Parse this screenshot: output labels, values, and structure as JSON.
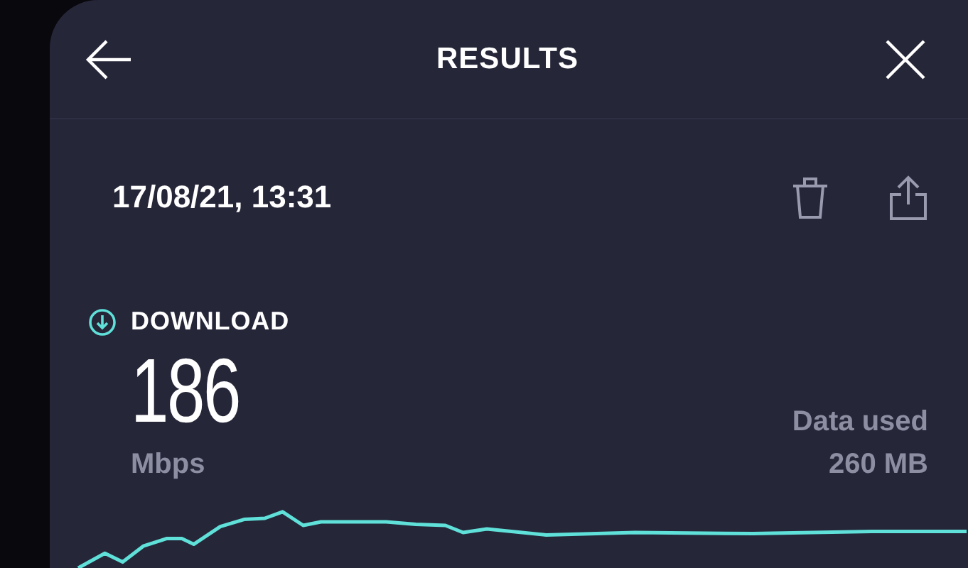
{
  "header": {
    "title": "RESULTS"
  },
  "result": {
    "timestamp": "17/08/21, 13:31"
  },
  "download": {
    "label": "DOWNLOAD",
    "value": "186",
    "unit": "Mbps",
    "data_used_label": "Data used",
    "data_used_value": "260 MB"
  }
}
